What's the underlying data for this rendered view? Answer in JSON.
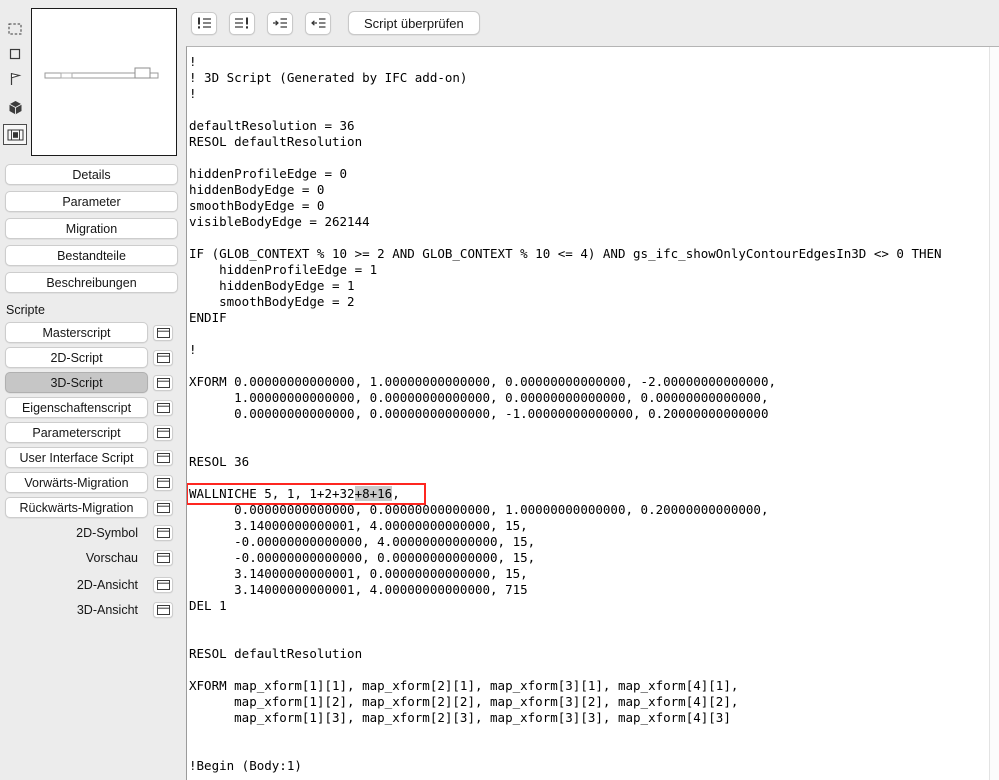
{
  "colors": {
    "window_bg": "#ececec",
    "button_bg": "#ffffff",
    "active_button_bg": "#c6c6c6",
    "highlight_red": "#fe2620",
    "selection_gray": "#c8c8c8",
    "code_bg": "#ffffff",
    "code_text": "#000000"
  },
  "preview_tools": {
    "icons": [
      "marquee-rect-icon",
      "square-icon",
      "flag-icon",
      "cube-icon",
      "filmstrip-icon"
    ],
    "selected_icon": "filmstrip-icon"
  },
  "sidebar": {
    "nav_buttons": [
      {
        "label": "Details"
      },
      {
        "label": "Parameter"
      },
      {
        "label": "Migration"
      },
      {
        "label": "Bestandteile"
      },
      {
        "label": "Beschreibungen"
      }
    ],
    "section_label": "Scripte",
    "script_rows": [
      {
        "label": "Masterscript",
        "active": false
      },
      {
        "label": "2D-Script",
        "active": false
      },
      {
        "label": "3D-Script",
        "active": true
      },
      {
        "label": "Eigenschaftenscript",
        "active": false
      },
      {
        "label": "Parameterscript",
        "active": false
      },
      {
        "label": "User Interface Script",
        "active": false
      },
      {
        "label": "Vorwärts-Migration",
        "active": false
      },
      {
        "label": "Rückwärts-Migration",
        "active": false
      }
    ],
    "plain_rows": [
      {
        "label": "2D-Symbol"
      },
      {
        "label": "Vorschau"
      }
    ],
    "view_rows": [
      {
        "label": "2D-Ansicht"
      },
      {
        "label": "3D-Ansicht"
      }
    ]
  },
  "toolbar": {
    "icon_buttons": [
      "comment-lines-icon",
      "uncomment-lines-icon",
      "indent-right-icon",
      "indent-left-icon"
    ],
    "check_button_label": "Script überprüfen"
  },
  "editor": {
    "lines": [
      "!",
      "! 3D Script (Generated by IFC add-on)",
      "!",
      "",
      "defaultResolution = 36",
      "RESOL defaultResolution",
      "",
      "hiddenProfileEdge = 0",
      "hiddenBodyEdge = 0",
      "smoothBodyEdge = 0",
      "visibleBodyEdge = 262144",
      "",
      "IF (GLOB_CONTEXT % 10 >= 2 AND GLOB_CONTEXT % 10 <= 4) AND gs_ifc_showOnlyContourEdgesIn3D <> 0 THEN",
      "    hiddenProfileEdge = 1",
      "    hiddenBodyEdge = 1",
      "    smoothBodyEdge = 2",
      "ENDIF",
      "",
      "!",
      "",
      "XFORM 0.00000000000000, 1.00000000000000, 0.00000000000000, -2.00000000000000,",
      "      1.00000000000000, 0.00000000000000, 0.00000000000000, 0.00000000000000,",
      "      0.00000000000000, 0.00000000000000, -1.00000000000000, 0.20000000000000",
      "",
      "",
      "RESOL 36",
      "",
      "WALLNICHE 5, 1, 1+2+32+8+16,",
      "      0.00000000000000, 0.00000000000000, 1.00000000000000, 0.20000000000000,",
      "      3.14000000000001, 4.00000000000000, 15,",
      "      -0.00000000000000, 4.00000000000000, 15,",
      "      -0.00000000000000, 0.00000000000000, 15,",
      "      3.14000000000001, 0.00000000000000, 15,",
      "      3.14000000000001, 4.00000000000000, 715",
      "DEL 1",
      "",
      "",
      "RESOL defaultResolution",
      "",
      "XFORM map_xform[1][1], map_xform[2][1], map_xform[3][1], map_xform[4][1],",
      "      map_xform[1][2], map_xform[2][2], map_xform[3][2], map_xform[4][2],",
      "      map_xform[1][3], map_xform[2][3], map_xform[3][3], map_xform[4][3]",
      "",
      "",
      "!Begin (Body:1)"
    ],
    "red_box_line_index": 27,
    "selection": {
      "before": "WALLNICHE 5, 1, 1+2+32",
      "selected": "+8+16",
      "after": ","
    }
  }
}
